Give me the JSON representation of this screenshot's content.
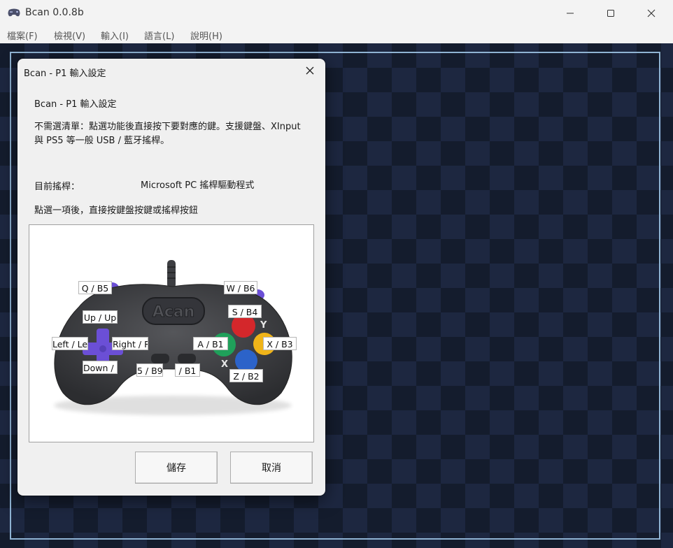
{
  "window": {
    "title": "Bcan 0.0.8b"
  },
  "menu": {
    "items": [
      "檔案(F)",
      "檢視(V)",
      "輸入(I)",
      "語言(L)",
      "說明(H)"
    ]
  },
  "dialog": {
    "title": "Bcan - P1 輸入設定",
    "heading": "Bcan - P1 輸入設定",
    "description": "不需選清單：點選功能後直接按下要對應的鍵。支援鍵盤、XInput 與 PS5 等一般 USB / 藍牙搖桿。",
    "current_joystick_label": "目前搖桿：",
    "current_joystick_value": "Microsoft PC 搖桿驅動程式",
    "instruction": "點選一項後，直接按鍵盤按鍵或搖桿按鈕",
    "controller": {
      "logo_text": "Acan",
      "face_letters": {
        "y": "Y",
        "x": "X"
      },
      "labels": {
        "l_shoulder": "Q / B5",
        "r_shoulder": "W / B6",
        "up": "Up / Up",
        "left": "Left / Left",
        "right": "Right / Right",
        "down": "Down / Down",
        "select": "5 / B9",
        "start": "/ B1",
        "a": "A / B1",
        "s": "S / B4",
        "x": "X / B3",
        "z": "Z / B2"
      }
    },
    "buttons": {
      "save": "儲存",
      "cancel": "取消"
    }
  },
  "colors": {
    "game_bg": "#141c2d",
    "frame_border": "#8fb3d3",
    "button_red": "#d4272b",
    "button_green": "#1fa05a",
    "button_blue": "#2c63c9",
    "button_yellow": "#f0b419",
    "dpad_purple": "#6b4fd6",
    "controller_body": "#3a3b3e"
  }
}
